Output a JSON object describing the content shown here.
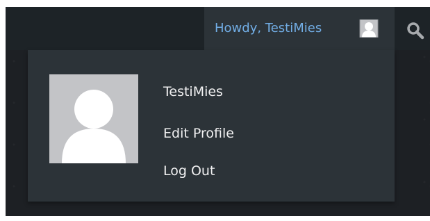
{
  "admin_bar": {
    "howdy_label": "Howdy, TestiMies",
    "search_icon": "search-icon",
    "avatar_icon": "avatar-icon"
  },
  "user_menu": {
    "display_name": "TestiMies",
    "edit_profile_label": "Edit Profile",
    "log_out_label": "Log Out"
  },
  "colors": {
    "admin_bar_bg": "#1d2327",
    "menu_bg": "#2c3338",
    "howdy_text": "#72aee6",
    "menu_text": "#f0f0f1",
    "avatar_bg": "#c3c4c7"
  }
}
